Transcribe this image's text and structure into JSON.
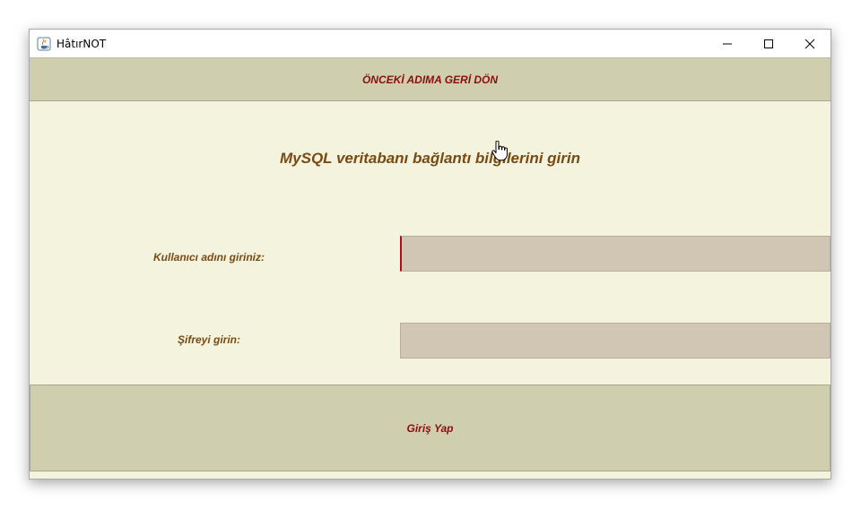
{
  "window": {
    "title": "HâtırNOT",
    "icons": {
      "app": "java-cup-icon",
      "minimize": "minimize-icon",
      "maximize": "maximize-icon",
      "close": "close-icon"
    }
  },
  "back_button": {
    "label": "ÖNCEKİ ADIMA GERİ DÖN"
  },
  "heading": "MySQL veritabanı bağlantı bilgilerini girin",
  "form": {
    "username_label": "Kullanıcı adını giriniz:",
    "username_value": "",
    "password_label": "Şifreyi girin:",
    "password_value": ""
  },
  "login_button": {
    "label": "Giriş Yap"
  },
  "colors": {
    "background": "#f4f3dd",
    "button_bg": "#cfceae",
    "button_text": "#8b0e0e",
    "label_text": "#7a4a12",
    "field_bg": "#d1c5b3"
  }
}
